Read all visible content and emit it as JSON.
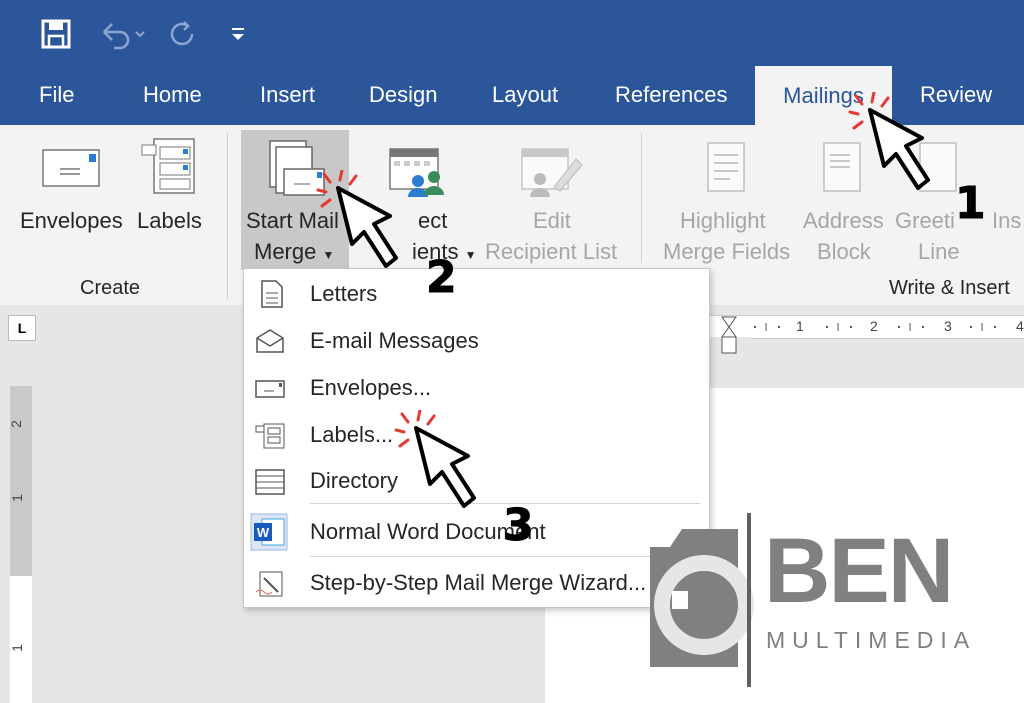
{
  "qat": {
    "save_icon": "save-icon",
    "undo_icon": "undo-icon",
    "redo_icon": "redo-icon",
    "customize_icon": "customize-qat-icon"
  },
  "tabs": [
    "File",
    "Home",
    "Insert",
    "Design",
    "Layout",
    "References",
    "Mailings",
    "Review"
  ],
  "active_tab": "Mailings",
  "ribbon": {
    "envelopes": "Envelopes",
    "labels": "Labels",
    "create_group": "Create",
    "start_mail_merge_1": "Start Mail",
    "start_mail_merge_2": "Merge",
    "select_recipients_1": "ect",
    "select_recipients_2": "ients",
    "edit_recipient_1": "Edit",
    "edit_recipient_2": "Recipient List",
    "highlight_1": "Highlight",
    "highlight_2": "Merge Fields",
    "address_1": "Address",
    "address_2": "Block",
    "greeting_1": "Greeti",
    "greeting_2": "Line",
    "insert_1": "Ins",
    "write_insert_group": "Write & Insert"
  },
  "menu": {
    "items": [
      {
        "label": "Letters",
        "icon": "letter-icon"
      },
      {
        "label": "E-mail Messages",
        "icon": "email-icon"
      },
      {
        "label": "Envelopes...",
        "icon": "envelope-icon"
      },
      {
        "label": "Labels...",
        "icon": "labels-icon"
      },
      {
        "label": "Directory",
        "icon": "directory-icon"
      },
      {
        "label": "Normal Word Document",
        "icon": "word-icon"
      },
      {
        "label": "Step-by-Step Mail Merge Wizard...",
        "icon": "wizard-icon"
      }
    ]
  },
  "ruler": {
    "marks": [
      "1",
      "2",
      "3",
      "4"
    ],
    "vmarks": [
      "2",
      "1",
      "1"
    ],
    "corner": "L"
  },
  "annotations": {
    "step1": "1",
    "step2": "2",
    "step3": "3"
  },
  "watermark": {
    "brand": "BEN",
    "sub": "MULTIMEDIA"
  },
  "colors": {
    "title_bar": "#2b579a",
    "ribbon": "#f3f3f3",
    "cursor_accent": "#e53935"
  }
}
